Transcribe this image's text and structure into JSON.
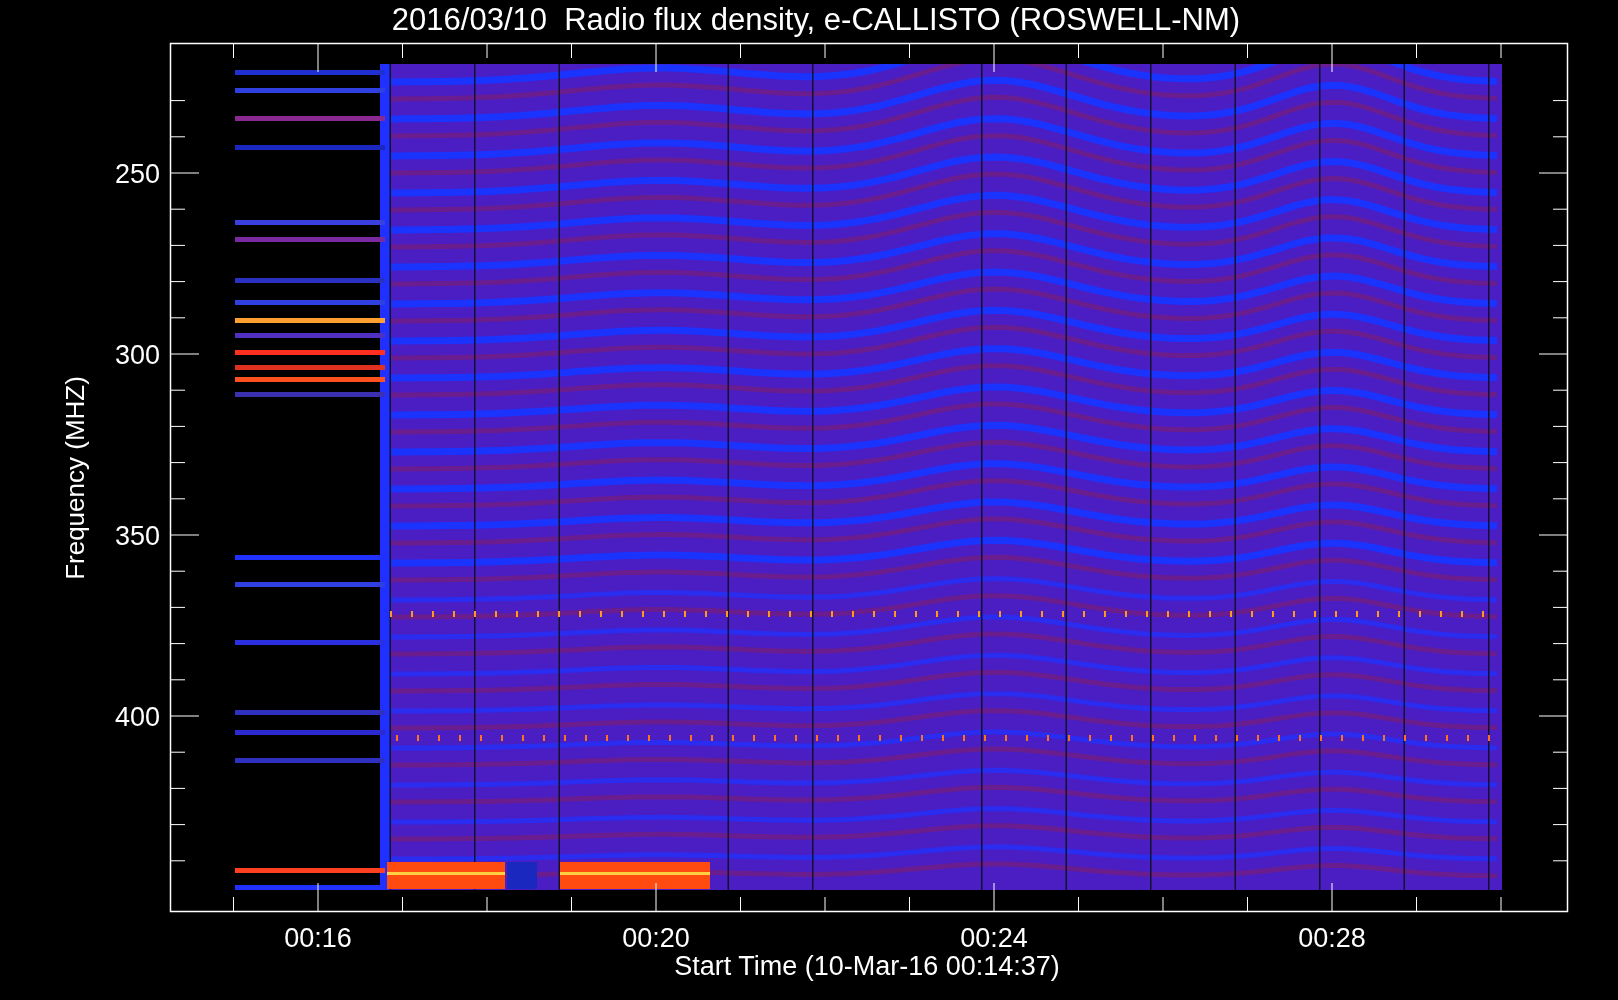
{
  "title": "2016/03/10  Radio flux density, e-CALLISTO (ROSWELL-NM)",
  "plot": {
    "ylabel": "Frequency (MHZ)",
    "xlabel": "Start Time (10-Mar-16 00:14:37)",
    "yticks": [
      "250",
      "300",
      "350",
      "400"
    ],
    "xticks": [
      "00:16",
      "00:20",
      "00:24",
      "00:28"
    ]
  }
}
